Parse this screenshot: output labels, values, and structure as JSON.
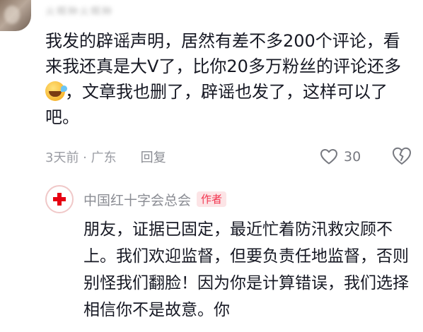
{
  "comment": {
    "username": "火啊种火啊种",
    "text_before_emoji": "我发的辟谣声明，居然有差不多200个评论，看来我还真是大V了，比你20多万粉丝的评论还多",
    "emoji": "laughing-with-tears",
    "text_after_emoji": "，文章我也删了，辟谣也发了，这样可以了吧。",
    "time_location": "3天前 · 广东",
    "reply_label": "回复",
    "like_count": "30"
  },
  "reply": {
    "author": "中国红十字会总会",
    "author_badge": "作者",
    "text": "朋友，证据已固定，最近忙着防汛救灾顾不上。我们欢迎监督，但要负责任地监督，否则别怪我们翻脸！因为你是计算错误，我们选择相信你不是故意。你"
  },
  "colors": {
    "text_primary": "#161823",
    "text_secondary": "#9a9ca3",
    "badge_text": "#f2354f",
    "badge_bg": "#fce4e6",
    "red_cross": "#e60012"
  }
}
